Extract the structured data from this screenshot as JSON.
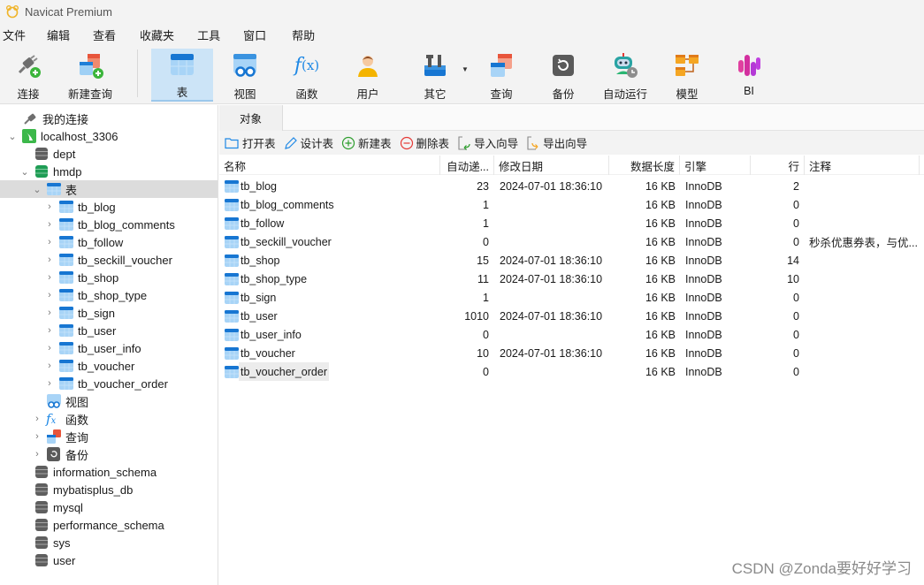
{
  "app": {
    "title": "Navicat Premium",
    "logo_icon": "navicat-logo-icon"
  },
  "menu": [
    "文件",
    "编辑",
    "查看",
    "收藏夹",
    "工具",
    "窗口",
    "帮助"
  ],
  "toolbar": {
    "items": [
      {
        "label": "连接",
        "icon": "connection-plug-icon"
      },
      {
        "label": "新建查询",
        "icon": "new-query-icon"
      },
      {
        "label": "表",
        "icon": "table-icon",
        "active": true
      },
      {
        "label": "视图",
        "icon": "view-icon"
      },
      {
        "label": "函数",
        "icon": "function-icon"
      },
      {
        "label": "用户",
        "icon": "user-icon"
      },
      {
        "label": "其它",
        "icon": "tools-icon",
        "dropdown": true
      },
      {
        "label": "查询",
        "icon": "query-icon"
      },
      {
        "label": "备份",
        "icon": "backup-icon"
      },
      {
        "label": "自动运行",
        "icon": "robot-icon"
      },
      {
        "label": "模型",
        "icon": "model-icon"
      },
      {
        "label": "BI",
        "icon": "bi-icon"
      }
    ]
  },
  "sidebar": {
    "root": "我的连接",
    "connection": "localhost_3306",
    "databases_before": [
      "dept"
    ],
    "active_db": "hmdp",
    "tables_node": "表",
    "tables": [
      "tb_blog",
      "tb_blog_comments",
      "tb_follow",
      "tb_seckill_voucher",
      "tb_shop",
      "tb_shop_type",
      "tb_sign",
      "tb_user",
      "tb_user_info",
      "tb_voucher",
      "tb_voucher_order"
    ],
    "other_nodes": [
      {
        "label": "视图",
        "icon": "view-icon",
        "expandable": false
      },
      {
        "label": "函数",
        "icon": "function-icon",
        "expandable": true
      },
      {
        "label": "查询",
        "icon": "query-icon",
        "expandable": true
      },
      {
        "label": "备份",
        "icon": "backup-icon",
        "expandable": true
      }
    ],
    "databases_after": [
      "information_schema",
      "mybatisplus_db",
      "mysql",
      "performance_schema",
      "sys",
      "user"
    ]
  },
  "main": {
    "tab": "对象",
    "actions": [
      {
        "label": "打开表",
        "icon": "folder-open-icon"
      },
      {
        "label": "设计表",
        "icon": "pencil-icon"
      },
      {
        "label": "新建表",
        "icon": "plus-circle-icon"
      },
      {
        "label": "删除表",
        "icon": "minus-circle-icon"
      },
      {
        "label": "导入向导",
        "icon": "import-icon"
      },
      {
        "label": "导出向导",
        "icon": "export-icon"
      }
    ],
    "columns": [
      "名称",
      "自动递...",
      "修改日期",
      "数据长度",
      "引擎",
      "行",
      "注释"
    ],
    "rows": [
      {
        "name": "tb_blog",
        "auto": "23",
        "date": "2024-07-01 18:36:10",
        "size": "16 KB",
        "engine": "InnoDB",
        "rows": "2",
        "comment": ""
      },
      {
        "name": "tb_blog_comments",
        "auto": "1",
        "date": "",
        "size": "16 KB",
        "engine": "InnoDB",
        "rows": "0",
        "comment": ""
      },
      {
        "name": "tb_follow",
        "auto": "1",
        "date": "",
        "size": "16 KB",
        "engine": "InnoDB",
        "rows": "0",
        "comment": ""
      },
      {
        "name": "tb_seckill_voucher",
        "auto": "0",
        "date": "",
        "size": "16 KB",
        "engine": "InnoDB",
        "rows": "0",
        "comment": "秒杀优惠券表，与优..."
      },
      {
        "name": "tb_shop",
        "auto": "15",
        "date": "2024-07-01 18:36:10",
        "size": "16 KB",
        "engine": "InnoDB",
        "rows": "14",
        "comment": ""
      },
      {
        "name": "tb_shop_type",
        "auto": "11",
        "date": "2024-07-01 18:36:10",
        "size": "16 KB",
        "engine": "InnoDB",
        "rows": "10",
        "comment": ""
      },
      {
        "name": "tb_sign",
        "auto": "1",
        "date": "",
        "size": "16 KB",
        "engine": "InnoDB",
        "rows": "0",
        "comment": ""
      },
      {
        "name": "tb_user",
        "auto": "1010",
        "date": "2024-07-01 18:36:10",
        "size": "16 KB",
        "engine": "InnoDB",
        "rows": "0",
        "comment": ""
      },
      {
        "name": "tb_user_info",
        "auto": "0",
        "date": "",
        "size": "16 KB",
        "engine": "InnoDB",
        "rows": "0",
        "comment": ""
      },
      {
        "name": "tb_voucher",
        "auto": "10",
        "date": "2024-07-01 18:36:10",
        "size": "16 KB",
        "engine": "InnoDB",
        "rows": "0",
        "comment": ""
      },
      {
        "name": "tb_voucher_order",
        "auto": "0",
        "date": "",
        "size": "16 KB",
        "engine": "InnoDB",
        "rows": "0",
        "comment": "",
        "selected": true
      }
    ]
  },
  "watermark": "CSDN @Zonda要好好学习"
}
